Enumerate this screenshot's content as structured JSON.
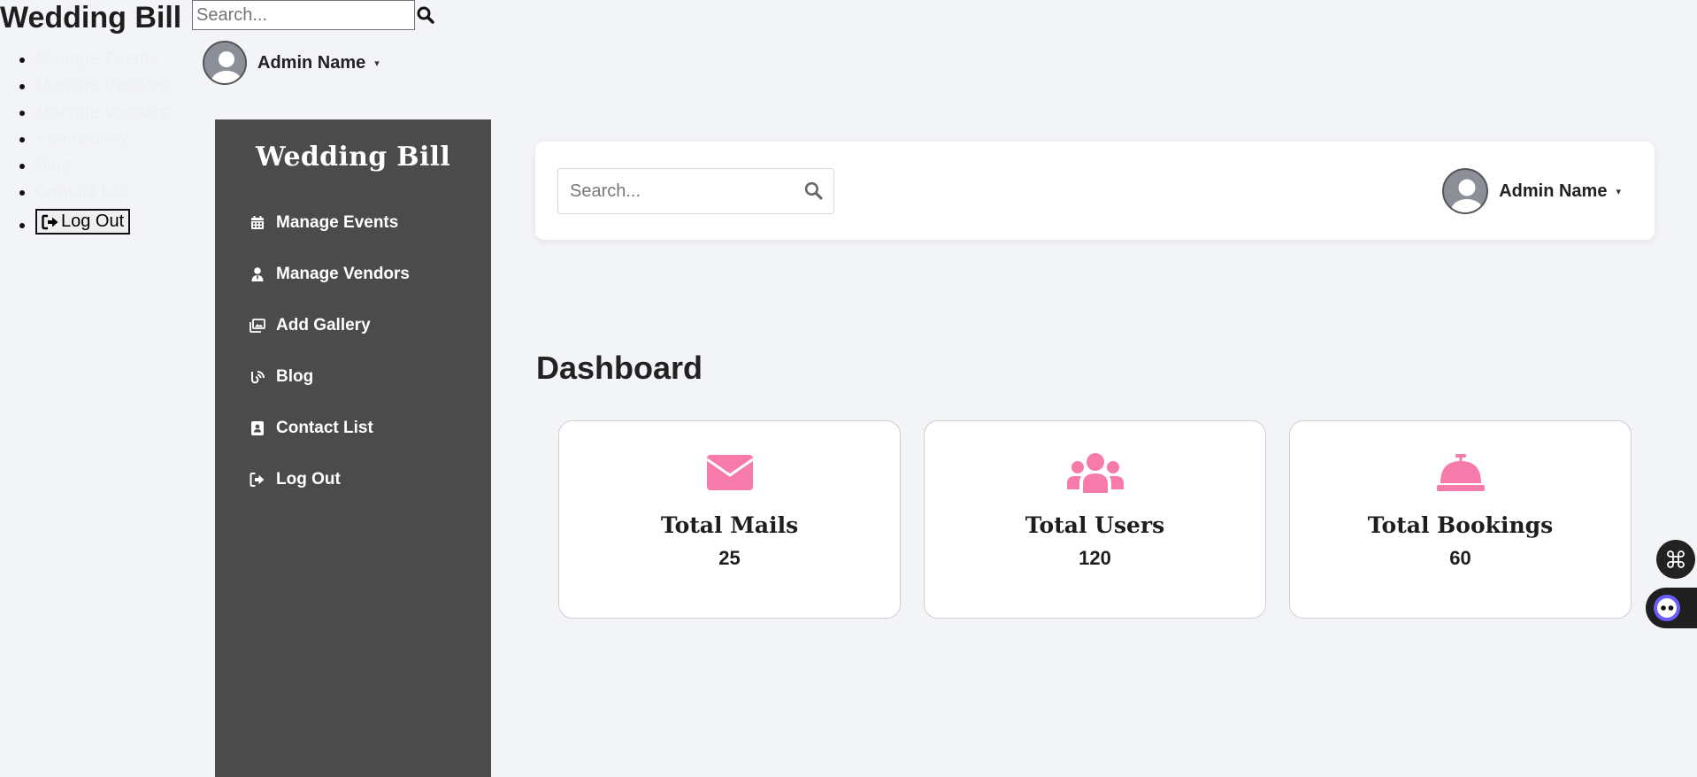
{
  "raw_header": {
    "title": "Wedding Bill",
    "search_placeholder": "Search...",
    "admin_name": "Admin Name",
    "caret": "▾",
    "nav_items": [
      "Manage Events",
      "Manage Vendors",
      "Manage Vendors",
      "Add Gallery",
      "Blog",
      "Contact List"
    ],
    "logout_label": "Log Out"
  },
  "sidebar": {
    "title": "Wedding Bill",
    "items": [
      {
        "label": "Manage Events",
        "icon": "calendar-icon"
      },
      {
        "label": "Manage Vendors",
        "icon": "vendor-user-icon"
      },
      {
        "label": "Add Gallery",
        "icon": "gallery-icon"
      },
      {
        "label": "Blog",
        "icon": "blog-icon"
      },
      {
        "label": "Contact List",
        "icon": "contact-book-icon"
      },
      {
        "label": "Log Out",
        "icon": "logout-icon"
      }
    ]
  },
  "header": {
    "search_placeholder": "Search...",
    "admin_name": "Admin Name",
    "caret": "▾"
  },
  "dashboard": {
    "title": "Dashboard",
    "cards": [
      {
        "label": "Total Mails",
        "value": "25",
        "icon": "envelope-icon"
      },
      {
        "label": "Total Users",
        "value": "120",
        "icon": "users-icon"
      },
      {
        "label": "Total Bookings",
        "value": "60",
        "icon": "concierge-bell-icon"
      }
    ]
  },
  "colors": {
    "sidebar_bg": "#4b4b4b",
    "accent_pink": "#f67aaa",
    "page_bg": "#f3f4f8"
  }
}
